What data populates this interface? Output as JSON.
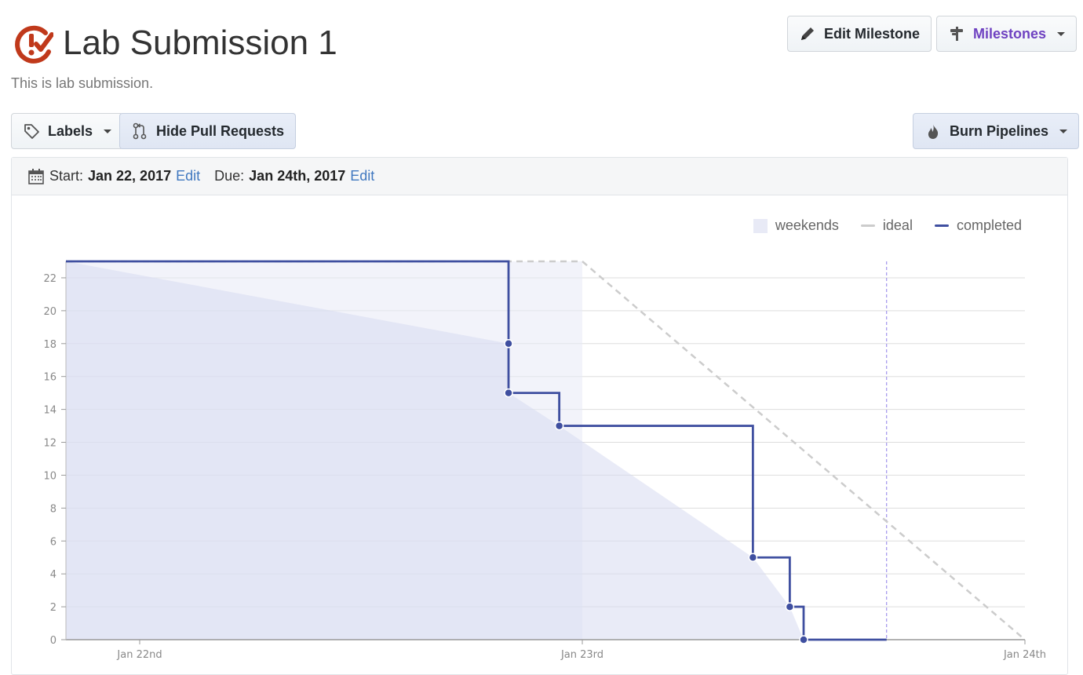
{
  "header": {
    "title": "Lab Submission 1",
    "description": "This is lab submission.",
    "logo_icon": "burnchart-logo-icon",
    "edit_milestone_label": "Edit Milestone",
    "milestones_label": "Milestones"
  },
  "toolbar": {
    "labels_label": "Labels",
    "hide_pr_label": "Hide Pull Requests",
    "burn_pipelines_label": "Burn Pipelines"
  },
  "dates": {
    "start_label": "Start:",
    "start_value": "Jan 22, 2017",
    "due_label": "Due:",
    "due_value": "Jan 24th, 2017",
    "edit_label": "Edit"
  },
  "legend": {
    "weekends": "weekends",
    "ideal": "ideal",
    "completed": "completed"
  },
  "colors": {
    "accent": "#3f4fa0",
    "link": "#4078c0",
    "milestones": "#6f42c1",
    "weekend": "#e8eaf6",
    "ideal": "#cccccc"
  },
  "chart_data": {
    "type": "line",
    "xlabel": "",
    "ylabel": "",
    "ylim": [
      0,
      23
    ],
    "yticks": [
      0,
      2,
      4,
      6,
      8,
      10,
      12,
      14,
      16,
      18,
      20,
      22
    ],
    "xlim": [
      "2017-01-21T20:00",
      "2017-01-24T00:00"
    ],
    "xticks": [
      {
        "x": "2017-01-22T00:00",
        "label": "Jan 22nd"
      },
      {
        "x": "2017-01-23T00:00",
        "label": "Jan 23rd"
      },
      {
        "x": "2017-01-24T00:00",
        "label": "Jan 24th"
      }
    ],
    "weekend_range": [
      "2017-01-21T20:00",
      "2017-01-23T00:00"
    ],
    "today": "2017-01-23T16:30",
    "legend_position": "top-right",
    "grid": true,
    "series": [
      {
        "name": "ideal",
        "style": "dashed",
        "points": [
          {
            "x": "2017-01-21T20:00",
            "y": 23
          },
          {
            "x": "2017-01-23T00:00",
            "y": 23
          },
          {
            "x": "2017-01-24T00:00",
            "y": 0
          }
        ]
      },
      {
        "name": "completed",
        "style": "step",
        "points": [
          {
            "x": "2017-01-21T20:00",
            "y": 23
          },
          {
            "x": "2017-01-22T20:00",
            "y": 18
          },
          {
            "x": "2017-01-22T20:00",
            "y": 15
          },
          {
            "x": "2017-01-22T22:45",
            "y": 13
          },
          {
            "x": "2017-01-23T09:15",
            "y": 5
          },
          {
            "x": "2017-01-23T11:15",
            "y": 2
          },
          {
            "x": "2017-01-23T12:00",
            "y": 0
          },
          {
            "x": "2017-01-23T16:30",
            "y": 0
          }
        ]
      }
    ]
  }
}
